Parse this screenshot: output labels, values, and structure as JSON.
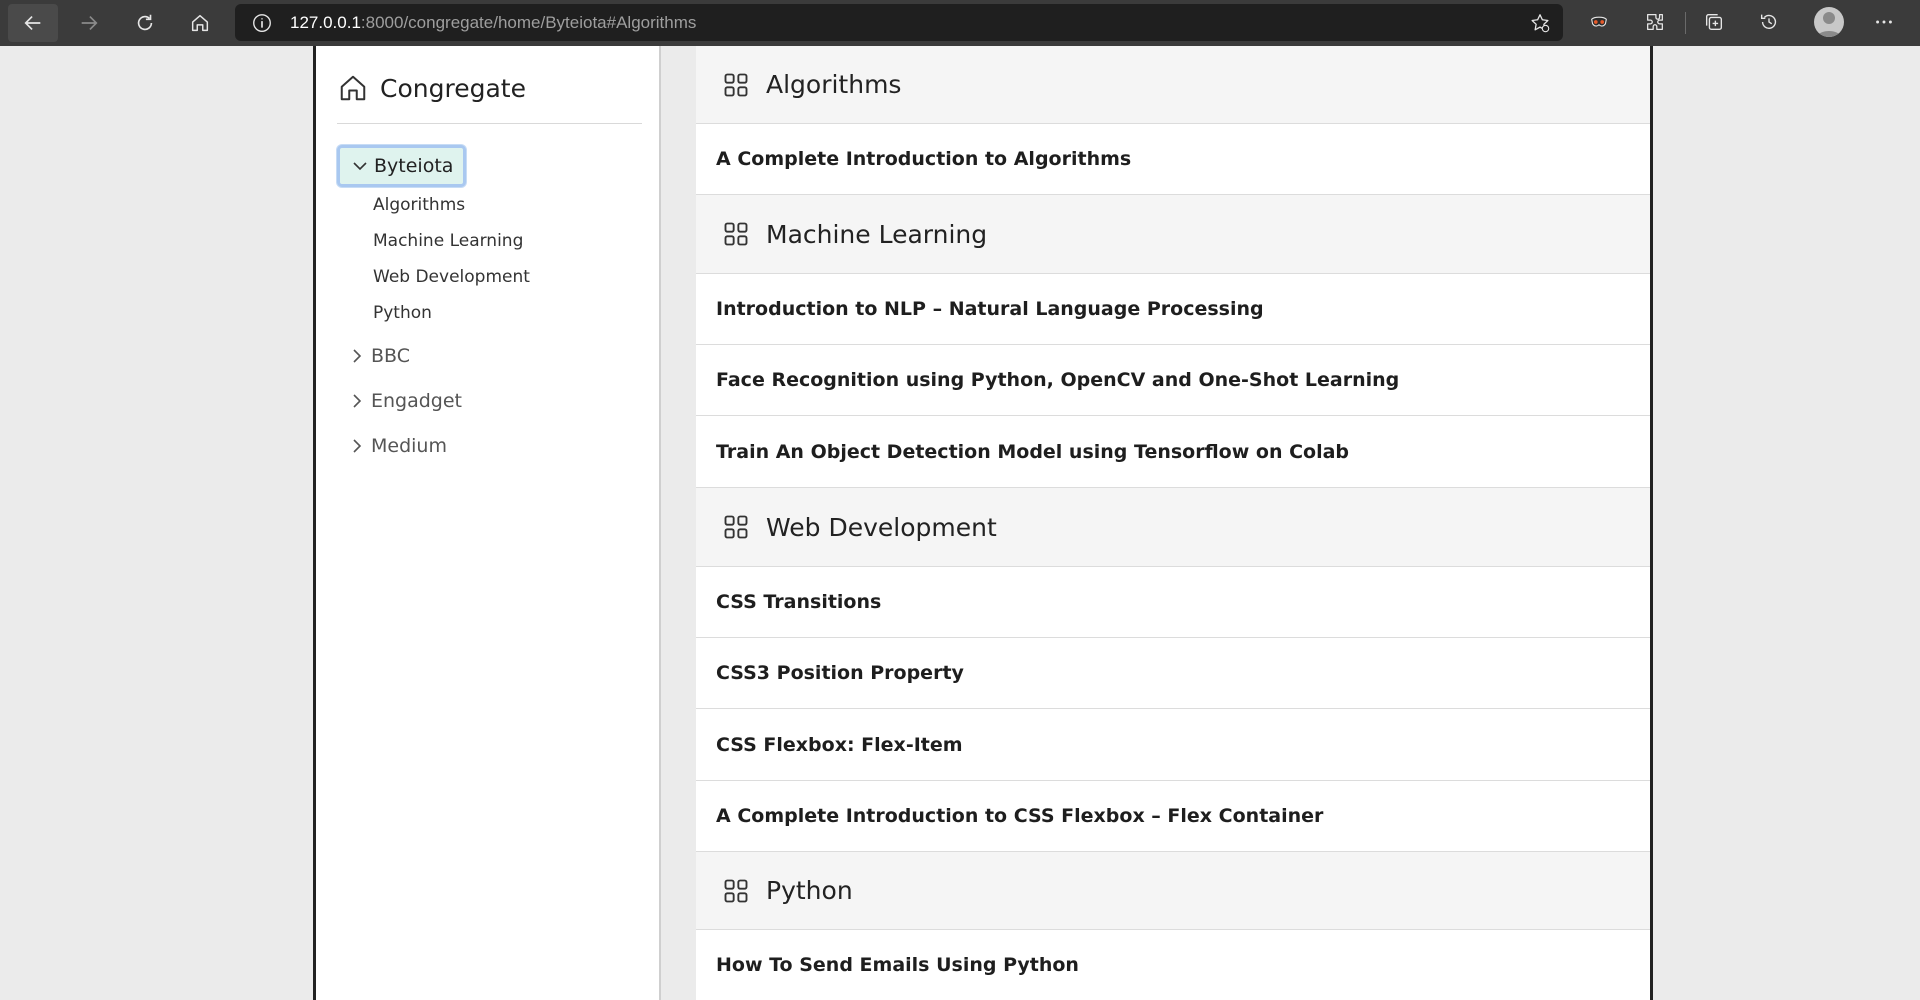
{
  "browser": {
    "url_host": "127.0.0.1",
    "url_rest": ":8000/congregate/home/Byteiota#Algorithms",
    "icons": [
      "back-icon",
      "forward-icon",
      "refresh-icon",
      "home-icon",
      "info-icon",
      "favorite-add-icon",
      "mask-extension-icon",
      "extensions-icon",
      "collections-icon",
      "history-icon",
      "profile-icon",
      "more-icon"
    ]
  },
  "sidebar": {
    "brand": "Congregate",
    "groups": [
      {
        "label": "Byteiota",
        "expanded": true,
        "items": [
          "Algorithms",
          "Machine Learning",
          "Web Development",
          "Python"
        ]
      },
      {
        "label": "BBC",
        "expanded": false
      },
      {
        "label": "Engadget",
        "expanded": false
      },
      {
        "label": "Medium",
        "expanded": false
      }
    ]
  },
  "main": {
    "sections": [
      {
        "title": "Algorithms",
        "articles": [
          "A Complete Introduction to Algorithms"
        ]
      },
      {
        "title": "Machine Learning",
        "articles": [
          "Introduction to NLP – Natural Language Processing",
          "Face Recognition using Python, OpenCV and One-Shot Learning",
          "Train An Object Detection Model using Tensorflow on Colab"
        ]
      },
      {
        "title": "Web Development",
        "articles": [
          "CSS Transitions",
          "CSS3 Position Property",
          "CSS Flexbox: Flex-Item",
          "A Complete Introduction to CSS Flexbox – Flex Container"
        ]
      },
      {
        "title": "Python",
        "articles": [
          "How To Send Emails Using Python"
        ]
      }
    ]
  },
  "colors": {
    "chrome": "#3b3b3b",
    "urlbar": "#1f1f1f",
    "selected_bg": "#dff3ee",
    "selected_border": "#a9c8f0",
    "section_bg": "#f5f5f5"
  }
}
